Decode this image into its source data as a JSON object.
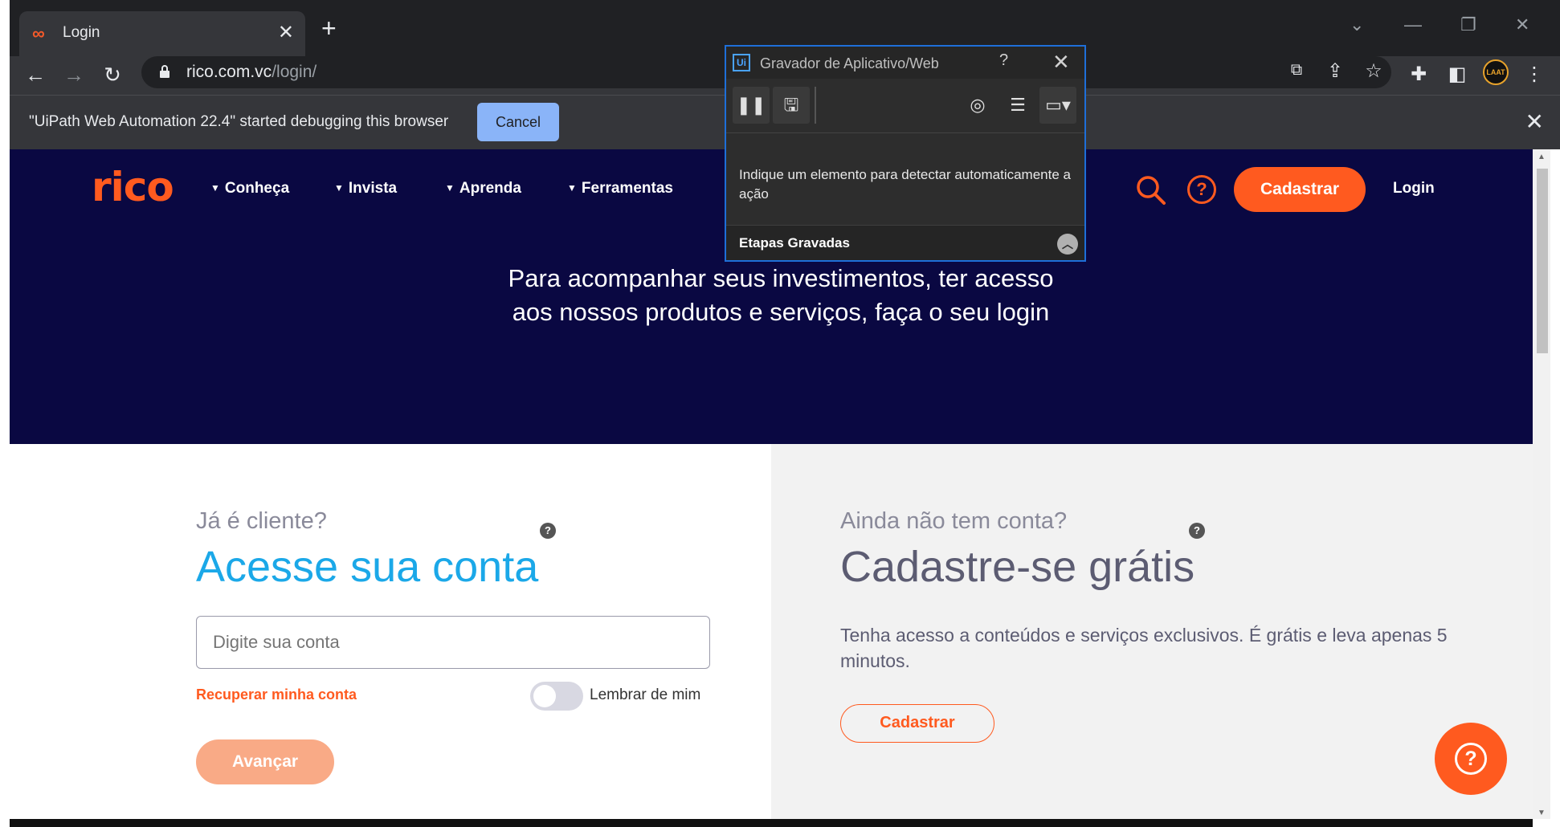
{
  "browser": {
    "tab_title": "Login",
    "tab_favicon": "rico-logo-icon",
    "url_host": "rico.com.vc",
    "url_path": "/login/",
    "infobar_text": "\"UiPath Web Automation 22.4\" started debugging this browser",
    "infobar_cancel": "Cancel",
    "avatar_text": "LAAT"
  },
  "site": {
    "logo": "rico",
    "nav": [
      "Conheça",
      "Invista",
      "Aprenda",
      "Ferramentas"
    ],
    "header_cadastrar": "Cadastrar",
    "header_login": "Login",
    "hero_title_line1": "Para acompanhar seus investimentos, ter acesso",
    "hero_title_line2": "aos nossos produtos e serviços, faça o seu login",
    "left": {
      "eyebrow": "Já é cliente?",
      "title": "Acesse sua conta",
      "input_placeholder": "Digite sua conta",
      "recover_link": "Recuperar minha conta",
      "remember_label": "Lembrar de mim",
      "remember_checked": false,
      "submit": "Avançar"
    },
    "right": {
      "eyebrow": "Ainda não tem conta?",
      "title": "Cadastre-se grátis",
      "text": "Tenha acesso a conteúdos e serviços exclusivos. É grátis e leva apenas 5 minutos.",
      "button": "Cadastrar"
    },
    "colors": {
      "brand_orange": "#ff5a1f",
      "hero_navy": "#0a0842",
      "title_blue": "#1ba8e8",
      "title_gray": "#5c5c72"
    }
  },
  "recorder": {
    "title": "Gravador de Aplicativo/Web",
    "help": "?",
    "instruction": "Indique um elemento para detectar automaticamente a ação",
    "footer_label": "Etapas Gravadas"
  }
}
